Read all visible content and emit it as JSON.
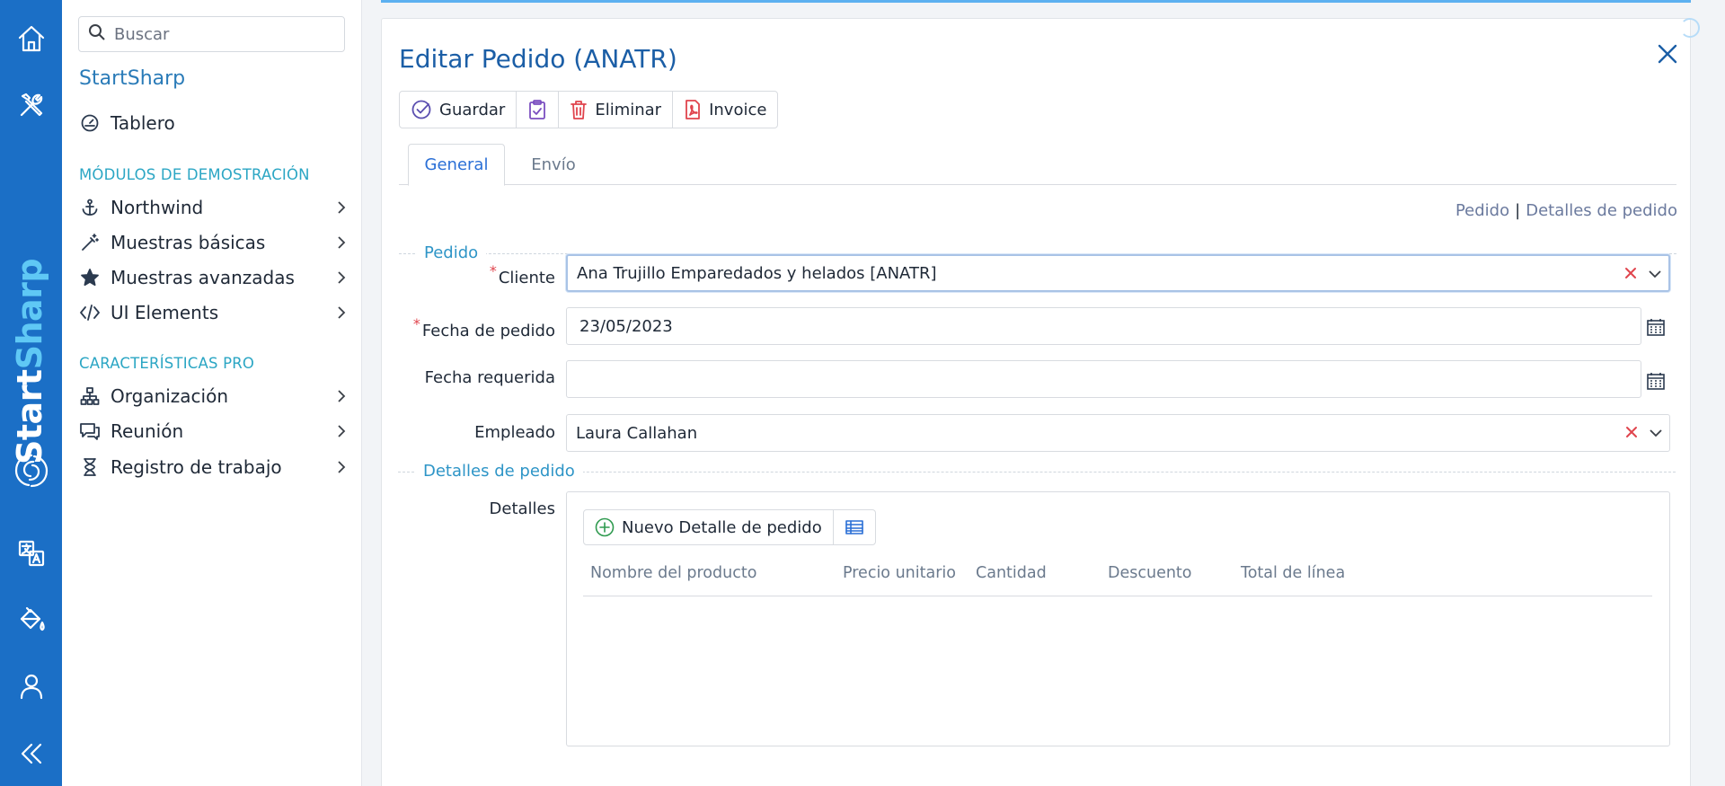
{
  "rail": {
    "brand_part1": "Start",
    "brand_part2": "Sharp",
    "icons": [
      "home-icon",
      "tools-icon",
      "translate-icon",
      "paint-bucket-icon",
      "user-icon",
      "collapse-icon"
    ]
  },
  "sidebar": {
    "search_placeholder": "Buscar",
    "app_title": "StartSharp",
    "dashboard": {
      "label": "Tablero",
      "icon": "gauge-icon"
    },
    "sections": [
      {
        "title": "MÓDULOS DE DEMOSTRACIÓN",
        "items": [
          {
            "label": "Northwind",
            "icon": "anchor-icon"
          },
          {
            "label": "Muestras básicas",
            "icon": "magic-wand-icon"
          },
          {
            "label": "Muestras avanzadas",
            "icon": "star-icon"
          },
          {
            "label": "UI Elements",
            "icon": "code-icon"
          }
        ]
      },
      {
        "title": "CARACTERÍSTICAS PRO",
        "items": [
          {
            "label": "Organización",
            "icon": "org-chart-icon"
          },
          {
            "label": "Reunión",
            "icon": "chat-icon"
          },
          {
            "label": "Registro de trabajo",
            "icon": "hourglass-icon"
          }
        ]
      }
    ]
  },
  "dialog": {
    "title": "Editar Pedido (ANATR)",
    "toolbar": {
      "save": "Guardar",
      "delete": "Eliminar",
      "invoice": "Invoice"
    },
    "tabs": [
      "General",
      "Envío"
    ],
    "links": [
      "Pedido",
      "Detalles de pedido"
    ],
    "link_separator": "|",
    "categories": [
      "Pedido",
      "Detalles de pedido"
    ],
    "fields": {
      "customer": {
        "label": "Cliente",
        "value": "Ana Trujillo Emparedados y helados [ANATR]",
        "required": true
      },
      "order_date": {
        "label": "Fecha de pedido",
        "value": "23/05/2023",
        "required": true
      },
      "required_date": {
        "label": "Fecha requerida",
        "value": ""
      },
      "employee": {
        "label": "Empleado",
        "value": "Laura Callahan"
      }
    },
    "details": {
      "label": "Detalles",
      "new_button": "Nuevo Detalle de pedido",
      "columns": [
        "Nombre del producto",
        "Precio unitario",
        "Cantidad",
        "Descuento",
        "Total de línea"
      ]
    }
  },
  "colors": {
    "rail": "#1b6fc6",
    "accent": "#1b5ea6",
    "section": "#2ba6c4",
    "required": "#e0444d"
  }
}
